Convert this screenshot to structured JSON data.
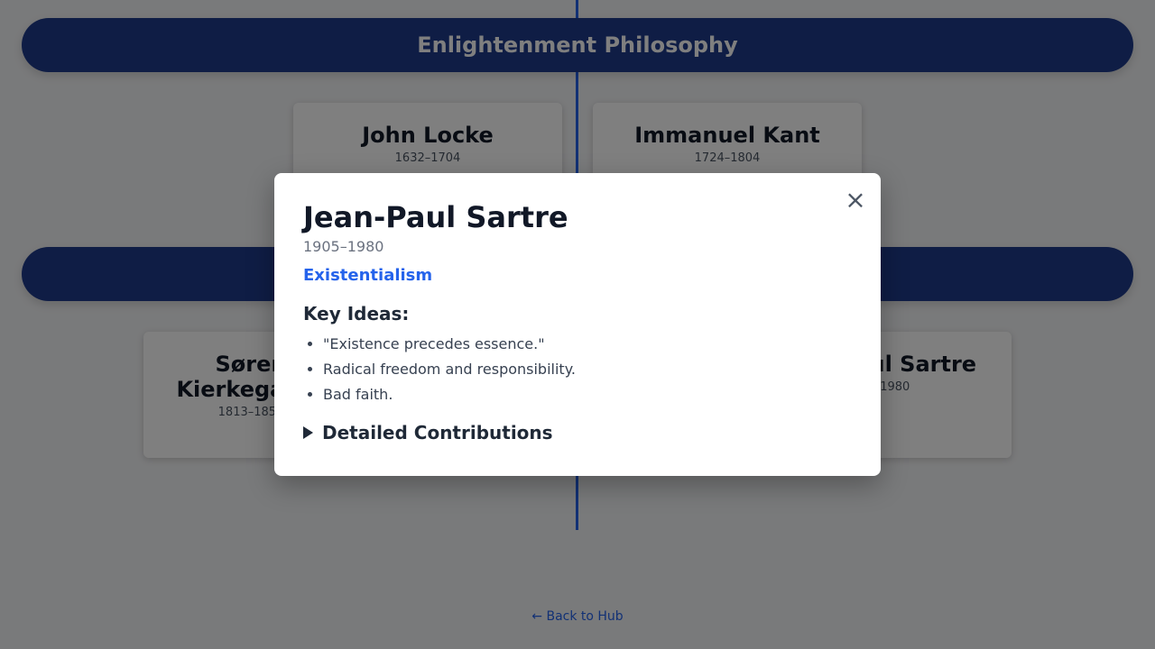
{
  "eras": [
    {
      "title": "Enlightenment Philosophy"
    },
    {
      "title": ""
    }
  ],
  "cards": [
    {
      "name": "John Locke",
      "dates": "1632–1704"
    },
    {
      "name": "Immanuel Kant",
      "dates": "1724–1804"
    },
    {
      "name": "Søren Kierkegaard",
      "dates": "1813–1855"
    },
    {
      "name": "Jean-Paul Sartre",
      "dates": "1905–1980"
    }
  ],
  "back_link": "← Back to Hub",
  "modal": {
    "close_icon": "close-icon",
    "close_glyph": "×",
    "name": "Jean-Paul Sartre",
    "dates": "1905–1980",
    "school": "Existentialism",
    "key_ideas_title": "Key Ideas:",
    "ideas": [
      "\"Existence precedes essence.\"",
      "Radical freedom and responsibility.",
      "Bad faith."
    ],
    "details_label": "Detailed Contributions"
  },
  "colors": {
    "accent": "#2563eb",
    "banner": "#1e3a8a"
  }
}
